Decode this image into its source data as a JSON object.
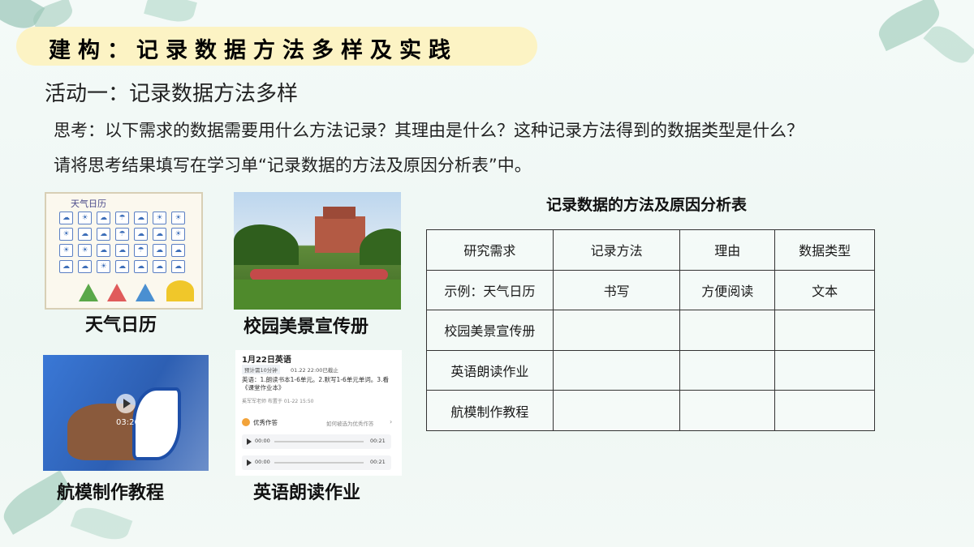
{
  "header": {
    "title": "建构：记录数据方法多样及实践"
  },
  "activity": {
    "subtitle": "活动一：记录数据方法多样",
    "question": "思考：以下需求的数据需要用什么方法记录？其理由是什么？这种记录方法得到的数据类型是什么？",
    "instruction": "请将思考结果填写在学习单“记录数据的方法及原因分析表”中。"
  },
  "images": {
    "calendar": {
      "caption": "天气日历",
      "heading": "天气日历"
    },
    "campus": {
      "caption": "校园美景宣传册"
    },
    "video": {
      "caption": "航模制作教程",
      "time": "03:26"
    },
    "homework": {
      "caption": "英语朗读作业",
      "title": "1月22日英语",
      "tag": "预计需10分钟",
      "deadline": "01.22 22:00已截止",
      "task": "英语：1.朗读书本1-6单元。2.默写1-6单元单词。3.看《课堂作业本》",
      "teacher": "奚军军老师 布置于 01-22 15:50",
      "excellent": "优秀作答",
      "excellent_link": "如何被选为优秀作答",
      "audio_start": "00:00",
      "audio_end": "00:21"
    }
  },
  "table": {
    "title": "记录数据的方法及原因分析表",
    "headers": [
      "研究需求",
      "记录方法",
      "理由",
      "数据类型"
    ],
    "rows": [
      [
        "示例：天气日历",
        "书写",
        "方便阅读",
        "文本"
      ],
      [
        "校园美景宣传册",
        "",
        "",
        ""
      ],
      [
        "英语朗读作业",
        "",
        "",
        ""
      ],
      [
        "航模制作教程",
        "",
        "",
        ""
      ]
    ]
  }
}
